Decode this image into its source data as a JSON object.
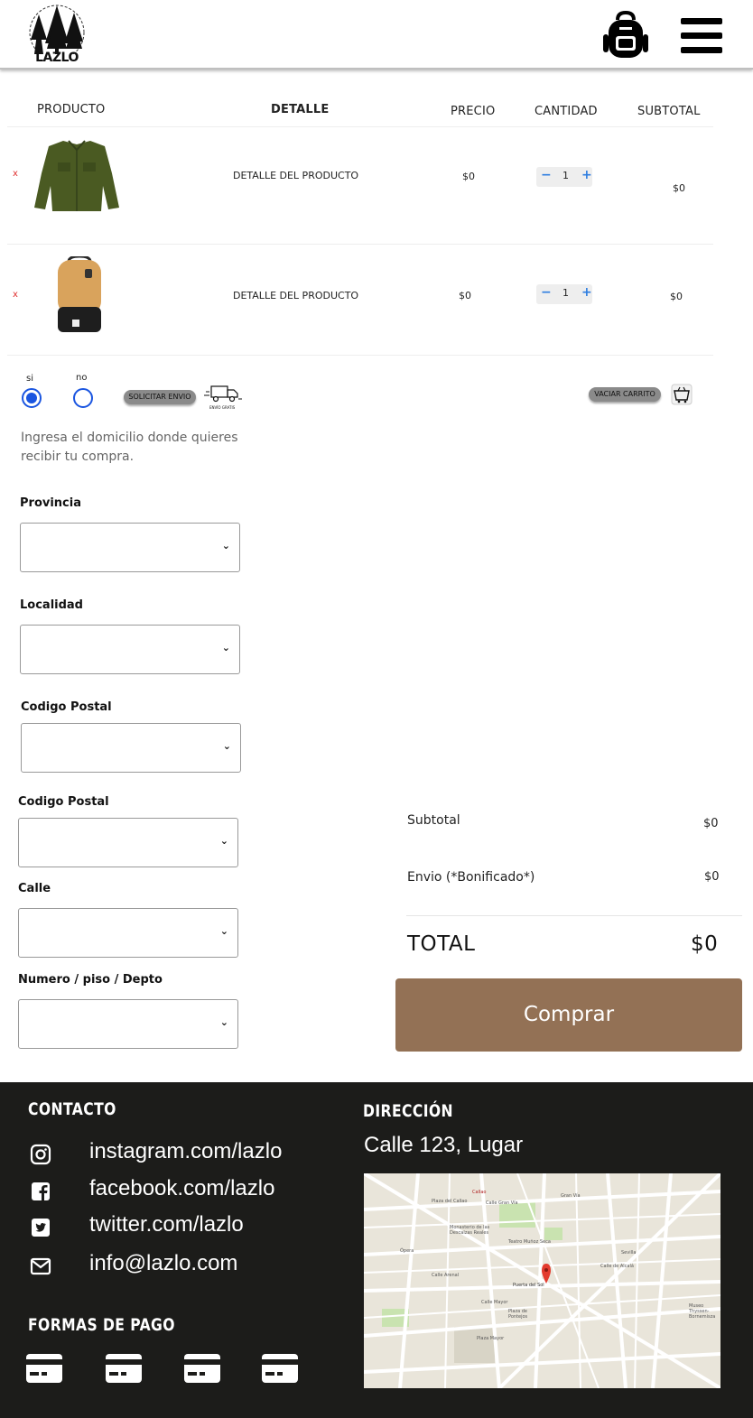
{
  "header": {
    "logo_text": "LAZLO",
    "cart_icon": "backpack-icon",
    "menu_icon": "hamburger-menu-icon"
  },
  "cart": {
    "columns": {
      "product": "PRODUCTO",
      "detail": "DETALLE",
      "price": "PRECIO",
      "quantity": "CANTIDAD",
      "subtotal": "SUBTOTAL"
    },
    "rows": [
      {
        "remove": "x",
        "image": "green-jacket",
        "detail": "DETALLE DEL PRODUCTO",
        "price": "$0",
        "minus": "−",
        "qty": "1",
        "plus": "+",
        "subtotal": "$0"
      },
      {
        "remove": "x",
        "image": "tan-backpack",
        "detail": "DETALLE DEL PRODUCTO",
        "price": "$0",
        "minus": "−",
        "qty": "1",
        "plus": "+",
        "subtotal": "$0"
      }
    ]
  },
  "shipping": {
    "yes_label": "si",
    "no_label": "no",
    "selected": "si",
    "request_button": "SOLICITAR ENVIO",
    "truck_caption": "ENVÍO GRATIS",
    "empty_cart_button": "VACIAR CARRITO",
    "intro": "Ingresa el domicilio donde quieres recibir tu compra."
  },
  "form": {
    "province_label": "Provincia",
    "locality_label": "Localidad",
    "postal_label_1": "Codigo Postal",
    "postal_label_2": "Codigo Postal",
    "street_label": "Calle",
    "number_label": "Numero / piso / Depto",
    "chevron": "⌄"
  },
  "totals": {
    "subtotal_label": "Subtotal",
    "subtotal_value": "$0",
    "shipping_label": "Envio (*Bonificado*)",
    "shipping_value": "$0",
    "total_label": "TOTAL",
    "total_value": "$0",
    "buy_button": "Comprar"
  },
  "footer": {
    "contact_title": "CONTACTO",
    "contacts": [
      {
        "icon": "instagram-icon",
        "text": "instagram.com/lazlo"
      },
      {
        "icon": "facebook-icon",
        "text": "facebook.com/lazlo"
      },
      {
        "icon": "twitter-icon",
        "text": "twitter.com/lazlo"
      },
      {
        "icon": "envelope-icon",
        "text": "info@lazlo.com"
      }
    ],
    "address_title": "DIRECCIÓN",
    "address": "Calle 123, Lugar",
    "payment_title": "FORMAS DE PAGO",
    "payment_icons": [
      "credit-card-icon",
      "credit-card-icon",
      "credit-card-icon",
      "credit-card-icon"
    ],
    "map_labels": [
      "Calle Gran Vía",
      "Callao",
      "Plaza del Callao",
      "Gran Vía",
      "Ópera",
      "Sevilla",
      "Puerta del Sol",
      "Calle Mayor",
      "Teatro Muñoz Seca",
      "Monasterio de las Descalzas Reales",
      "Plaza de Pontejos",
      "Calle de Alcalá",
      "Museo Thyssen-Bornemisza",
      "Calle Arenal",
      "Plaza Mayor"
    ]
  },
  "colors": {
    "accent_brown": "#937155",
    "footer_bg": "#1c1c1a",
    "radio_blue": "#1a55e0",
    "qty_blue": "#2d7de0",
    "remove_red": "#e03030"
  }
}
